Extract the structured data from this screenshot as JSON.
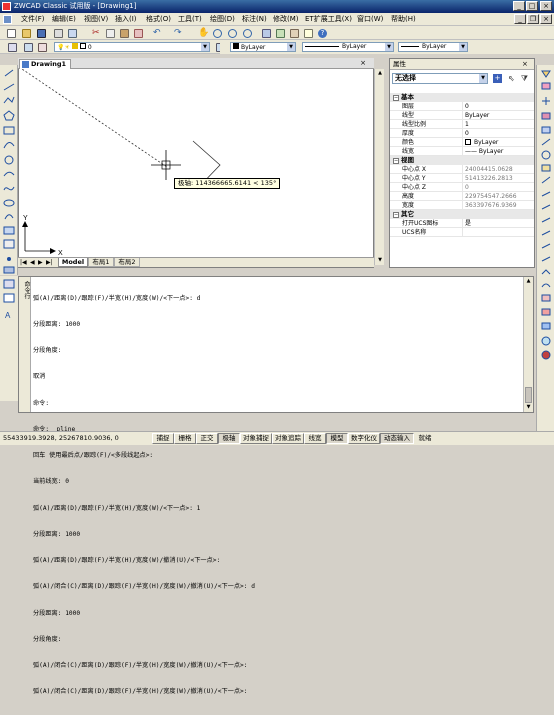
{
  "window": {
    "title": "ZWCAD Classic 试用版 - [Drawing1]"
  },
  "menu": [
    "文件(F)",
    "编辑(E)",
    "视图(V)",
    "插入(I)",
    "格式(O)",
    "工具(T)",
    "绘图(D)",
    "标注(N)",
    "修改(M)",
    "ET扩展工具(X)",
    "窗口(W)",
    "帮助(H)"
  ],
  "toolbar2": {
    "layer_combo": "0"
  },
  "toolbar3": {
    "color_combo": "ByLayer",
    "linetype_combo": "ByLayer",
    "lineweight_combo": "ByLayer"
  },
  "drawing": {
    "doc_tab": "Drawing1",
    "tooltip": "极轴: 114366665.6141 < 135°",
    "axis_x": "X",
    "axis_y": "Y"
  },
  "layout_tabs": [
    "Model",
    "布局1",
    "布局2"
  ],
  "properties": {
    "title": "属性",
    "selection": "无选择",
    "cat_basic": "基本",
    "cat_view": "视图",
    "cat_other": "其它",
    "basic": [
      {
        "name": "图层",
        "value": "0"
      },
      {
        "name": "线型",
        "value": "ByLayer"
      },
      {
        "name": "线型比例",
        "value": "1"
      },
      {
        "name": "厚度",
        "value": "0"
      },
      {
        "name": "颜色",
        "value": "ByLayer"
      },
      {
        "name": "线宽",
        "value": "—— ByLayer"
      }
    ],
    "view": [
      {
        "name": "中心点 X",
        "value": "24004415.0628"
      },
      {
        "name": "中心点 Y",
        "value": "51413226.2813"
      },
      {
        "name": "中心点 Z",
        "value": "0"
      },
      {
        "name": "高度",
        "value": "229754547.2666"
      },
      {
        "name": "宽度",
        "value": "363397676.9369"
      }
    ],
    "other": [
      {
        "name": "打开UCS图标",
        "value": "是"
      },
      {
        "name": "UCS名称",
        "value": ""
      }
    ]
  },
  "command": {
    "sidebar_label": "命令行",
    "lines": [
      "弧(A)/距离(D)/跟踪(F)/半宽(H)/宽度(W)/<下一点>: d",
      "分段距离: 1000",
      "分段角度:",
      "取消",
      "命令:",
      "命令: _pline",
      "回车 使用最后点/跟踪(F)/<多段线起点>:",
      "当前线宽: 0",
      "弧(A)/距离(D)/跟踪(F)/半宽(H)/宽度(W)/<下一点>: 1",
      "分段距离: 1000",
      "弧(A)/距离(D)/跟踪(F)/半宽(H)/宽度(W)/撤消(U)/<下一点>:",
      "弧(A)/闭合(C)/距离(D)/跟踪(F)/半宽(H)/宽度(W)/撤消(U)/<下一点>: d",
      "分段距离: 1000",
      "分段角度:",
      "弧(A)/闭合(C)/距离(D)/跟踪(F)/半宽(H)/宽度(W)/撤消(U)/<下一点>:",
      "弧(A)/闭合(C)/距离(D)/跟踪(F)/半宽(H)/宽度(W)/撤消(U)/<下一点>:"
    ]
  },
  "status": {
    "coords": "55433919.3928, 25267810.9036, 0",
    "buttons": [
      "捕捉",
      "栅格",
      "正交",
      "极轴",
      "对象捕捉",
      "对象追踪",
      "线宽",
      "模型",
      "数字化仪",
      "动态输入",
      "就绪"
    ]
  }
}
